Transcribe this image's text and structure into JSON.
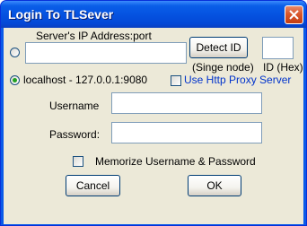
{
  "window": {
    "title": "Login To TLSever"
  },
  "server": {
    "label": "Server's IP Address:port",
    "ip_value": "",
    "detect_button": "Detect ID",
    "detect_note": "(Singe node)",
    "id_value": "",
    "id_label": "ID (Hex)"
  },
  "localhost": {
    "label": "localhost - 127.0.0.1:9080",
    "checked": true
  },
  "proxy": {
    "label": "Use Http Proxy Server",
    "checked": false
  },
  "credentials": {
    "username_label": "Username",
    "username_value": "",
    "password_label": "Password:",
    "password_value": ""
  },
  "memorize": {
    "label": "Memorize Username & Password",
    "checked": false
  },
  "buttons": {
    "cancel": "Cancel",
    "ok": "OK"
  },
  "icons": {
    "close": "close-icon"
  },
  "colors": {
    "titlebar": "#0553e1",
    "dialog_bg": "#ece9d8",
    "link_blue": "#0033cc",
    "close_red": "#d9572b"
  }
}
